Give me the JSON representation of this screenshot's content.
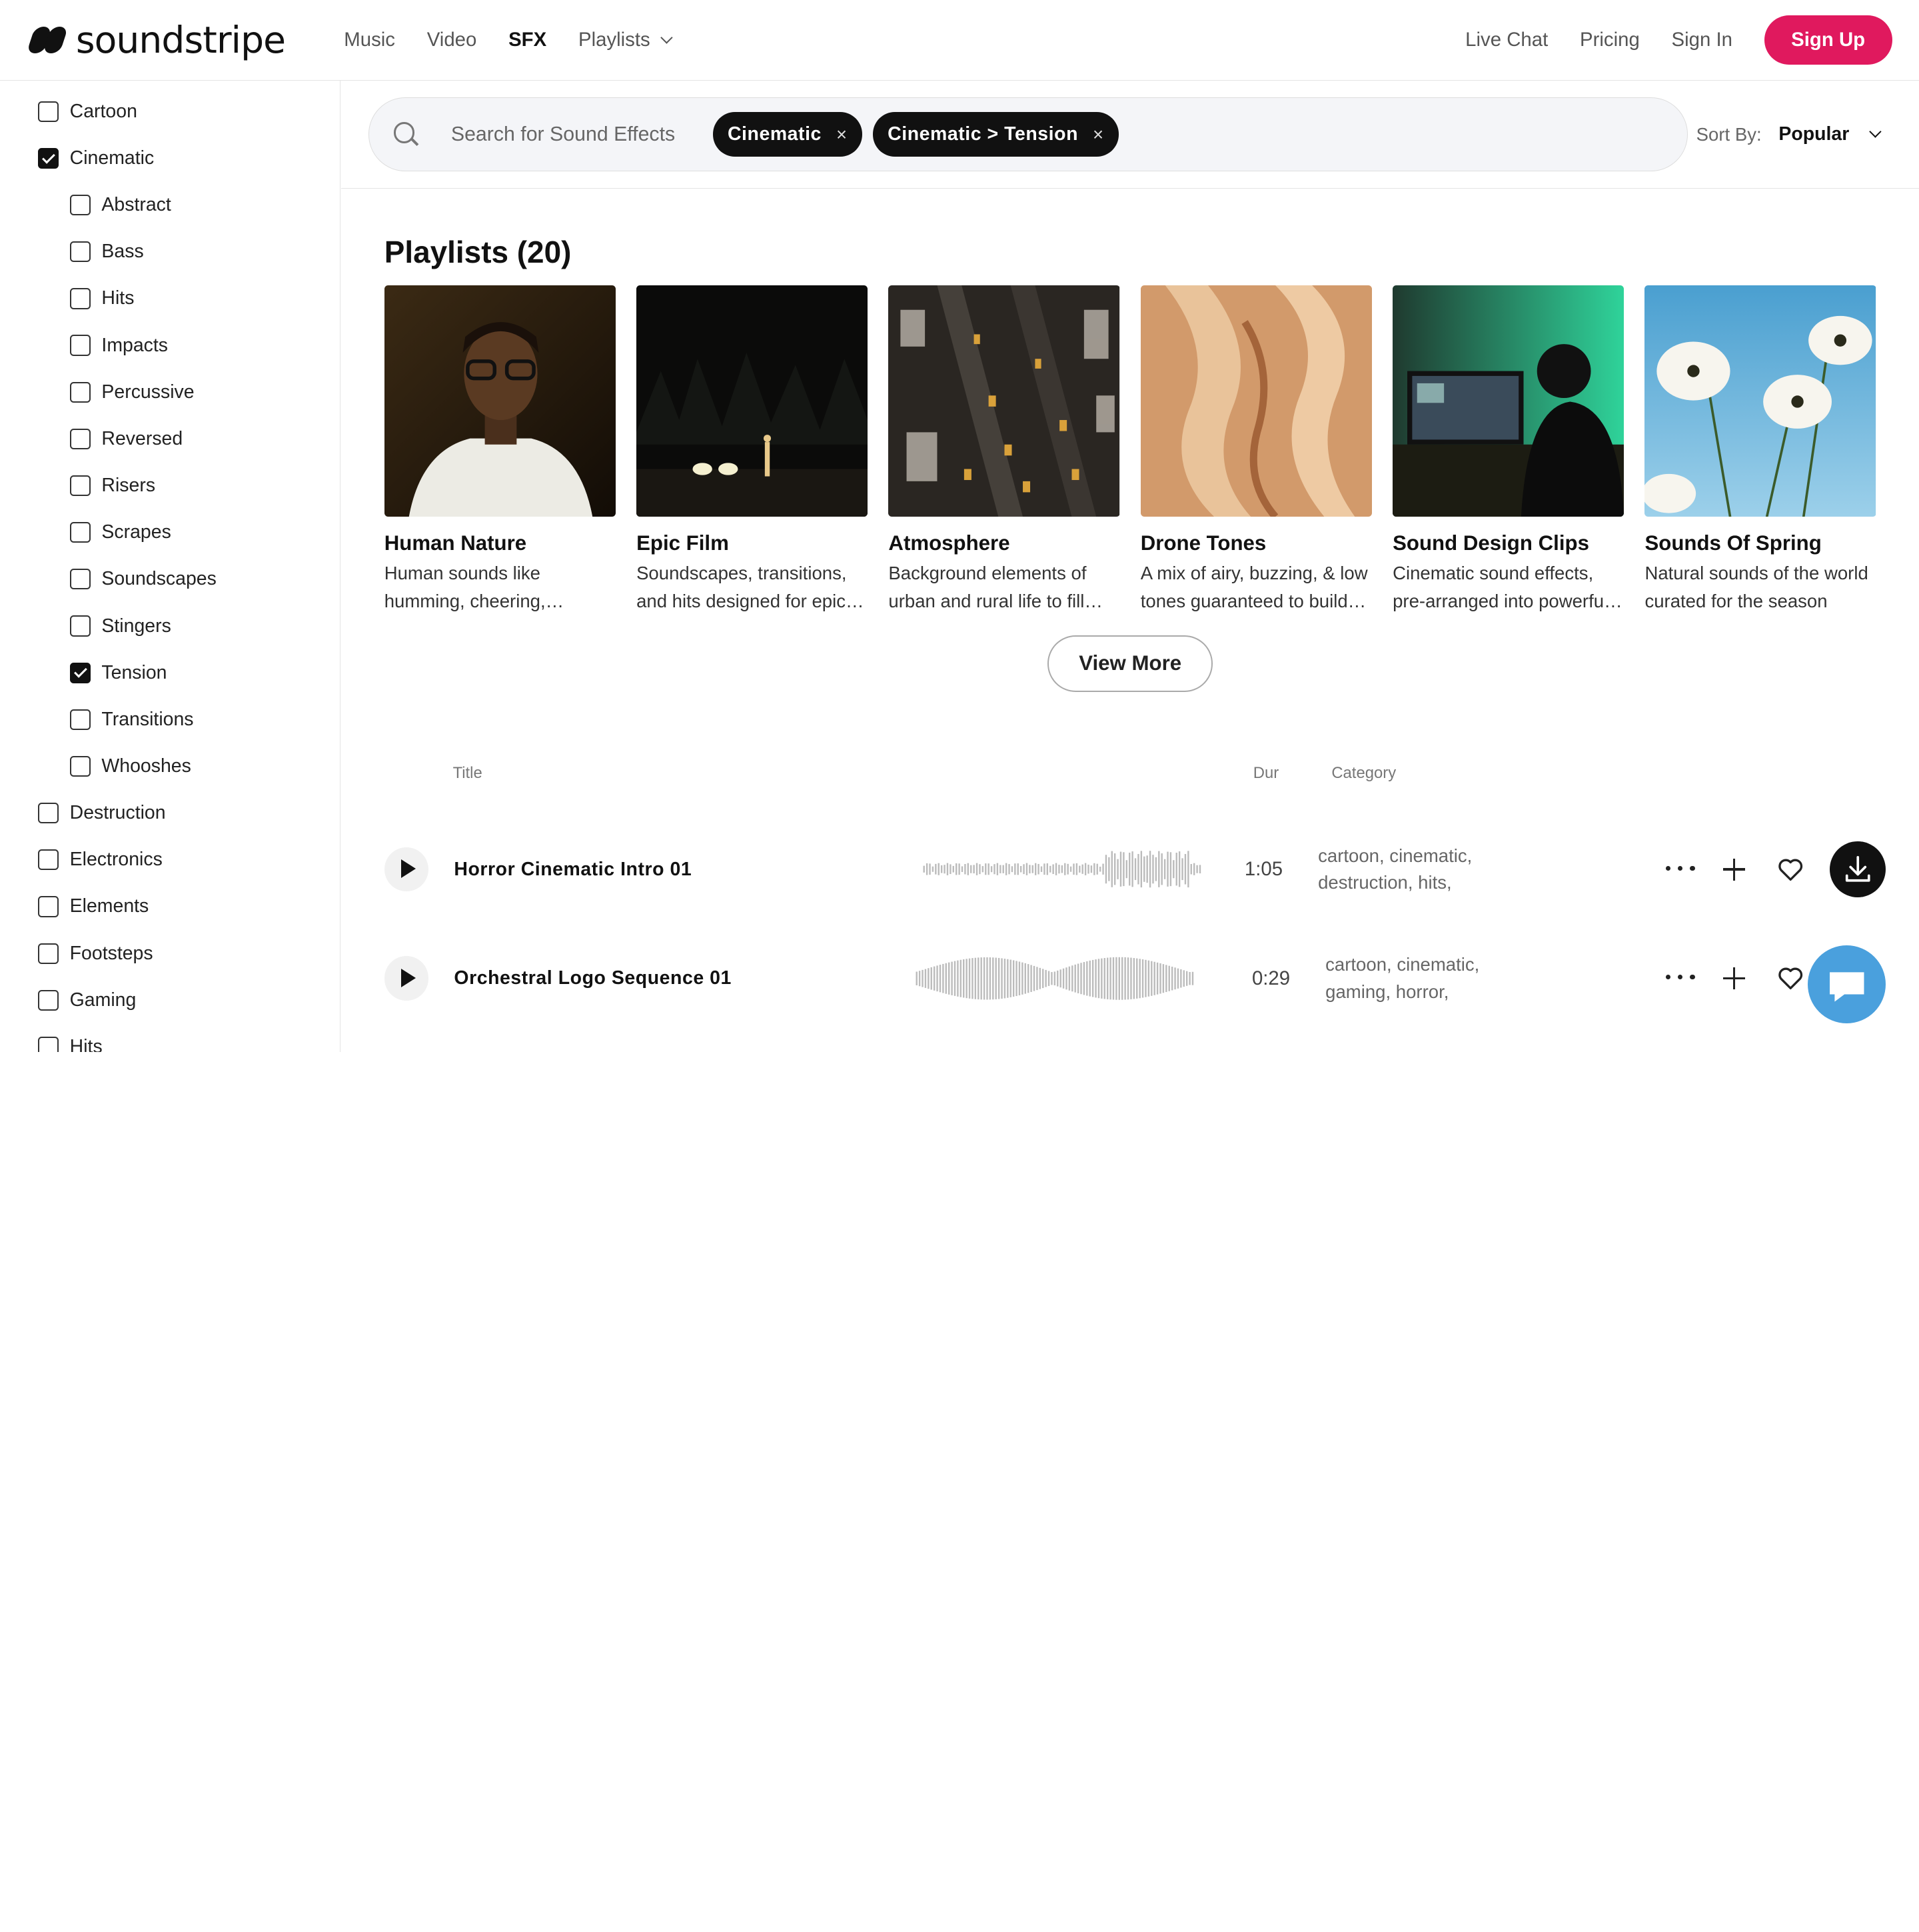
{
  "header": {
    "logo_text": "soundstripe",
    "nav": [
      "Music",
      "Video",
      "SFX",
      "Playlists"
    ],
    "active_nav": "SFX",
    "right_links": [
      "Live Chat",
      "Pricing",
      "Sign In"
    ],
    "signup_label": "Sign Up",
    "accent_color": "#e0195e"
  },
  "sidebar": {
    "filters": [
      {
        "label": "Cartoon",
        "checked": false,
        "level": 0
      },
      {
        "label": "Cinematic",
        "checked": true,
        "level": 0
      },
      {
        "label": "Abstract",
        "checked": false,
        "level": 1
      },
      {
        "label": "Bass",
        "checked": false,
        "level": 1
      },
      {
        "label": "Hits",
        "checked": false,
        "level": 1
      },
      {
        "label": "Impacts",
        "checked": false,
        "level": 1
      },
      {
        "label": "Percussive",
        "checked": false,
        "level": 1
      },
      {
        "label": "Reversed",
        "checked": false,
        "level": 1
      },
      {
        "label": "Risers",
        "checked": false,
        "level": 1
      },
      {
        "label": "Scrapes",
        "checked": false,
        "level": 1
      },
      {
        "label": "Soundscapes",
        "checked": false,
        "level": 1
      },
      {
        "label": "Stingers",
        "checked": false,
        "level": 1
      },
      {
        "label": "Tension",
        "checked": true,
        "level": 1
      },
      {
        "label": "Transitions",
        "checked": false,
        "level": 1
      },
      {
        "label": "Whooshes",
        "checked": false,
        "level": 1
      },
      {
        "label": "Destruction",
        "checked": false,
        "level": 0
      },
      {
        "label": "Electronics",
        "checked": false,
        "level": 0
      },
      {
        "label": "Elements",
        "checked": false,
        "level": 0
      },
      {
        "label": "Footsteps",
        "checked": false,
        "level": 0
      },
      {
        "label": "Gaming",
        "checked": false,
        "level": 0
      },
      {
        "label": "Hits",
        "checked": false,
        "level": 0
      }
    ]
  },
  "search": {
    "placeholder": "Search for Sound Effects",
    "chips": [
      "Cinematic",
      "Cinematic > Tension"
    ],
    "chip_remove": "×",
    "sort_label": "Sort By:",
    "sort_value": "Popular"
  },
  "playlists": {
    "title": "Playlists (20)",
    "items": [
      {
        "name": "Human Nature",
        "desc": "Human sounds like humming, cheering, clapping and more"
      },
      {
        "name": "Epic Film",
        "desc": "Soundscapes, transitions, and hits designed for epic scenes"
      },
      {
        "name": "Atmosphere",
        "desc": "Background elements of urban and rural life to fill your scene"
      },
      {
        "name": "Drone Tones",
        "desc": "A mix of airy, buzzing, & low tones guaranteed to build tension"
      },
      {
        "name": "Sound Design Clips",
        "desc": "Cinematic sound effects, pre-arranged into powerful clips"
      },
      {
        "name": "Sounds Of Spring",
        "desc": "Natural sounds of the world curated for the season"
      }
    ],
    "view_more": "View More"
  },
  "table": {
    "headers": {
      "title": "Title",
      "dur": "Dur",
      "category": "Category"
    },
    "tracks": [
      {
        "title": "Horror Cinematic Intro 01",
        "dur": "1:05",
        "category": "cartoon, cinematic, destruction, hits,"
      },
      {
        "title": "Orchestral Logo Sequence 01",
        "dur": "0:29",
        "category": "cartoon, cinematic, gaming, horror,"
      }
    ]
  }
}
